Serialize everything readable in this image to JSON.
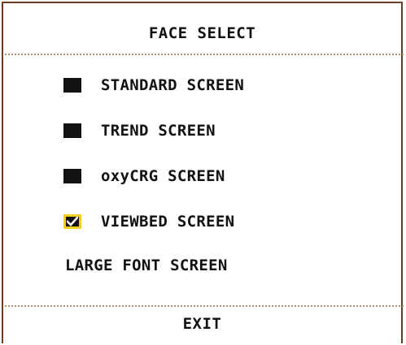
{
  "dialog": {
    "title": "FACE SELECT",
    "options": [
      {
        "label": "STANDARD SCREEN",
        "checked": false
      },
      {
        "label": "TREND SCREEN",
        "checked": false
      },
      {
        "label": "oxyCRG SCREEN",
        "checked": false
      },
      {
        "label": "VIEWBED SCREEN",
        "checked": true
      }
    ],
    "large_font_label": "LARGE FONT SCREEN",
    "exit_label": "EXIT"
  },
  "colors": {
    "frame": "#6b3d22",
    "divider": "#b08d6a",
    "checkbox_highlight": "#f2cf1f",
    "text": "#111111"
  }
}
